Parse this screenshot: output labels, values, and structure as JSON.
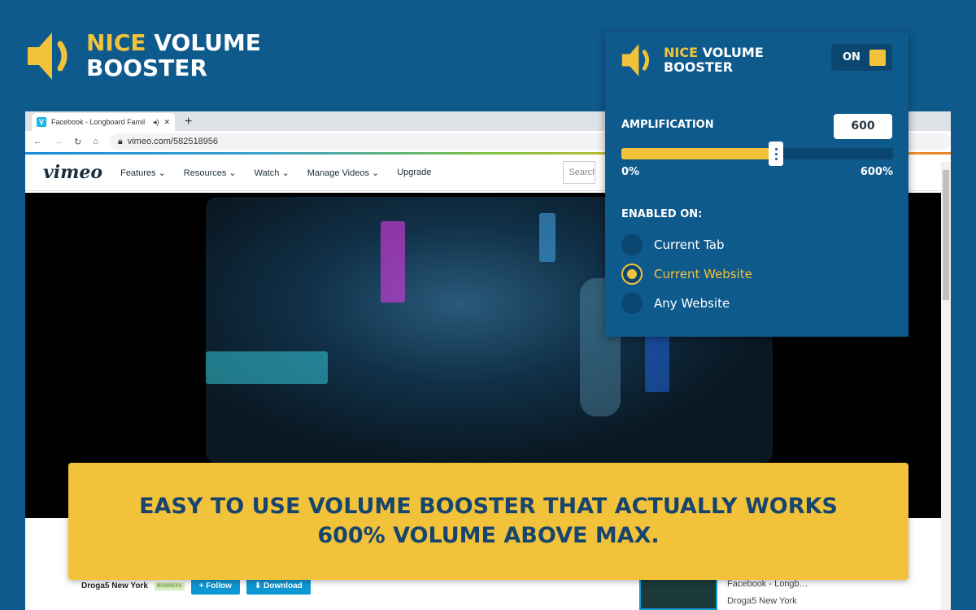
{
  "brand": {
    "nice": "NICE",
    "volume": "VOLUME",
    "booster": "BOOSTER"
  },
  "browser": {
    "tab_title": "Facebook - Longboard Famil",
    "new_tab": "+",
    "close": "✕",
    "url": "vimeo.com/582518956",
    "search_placeholder": "Search"
  },
  "vimeo": {
    "logo": "vimeo",
    "nav": [
      "Features ⌄",
      "Resources ⌄",
      "Watch ⌄",
      "Manage Videos ⌄",
      "Upgrade"
    ]
  },
  "popup": {
    "toggle_label": "ON",
    "amplification_label": "AMPLIFICATION",
    "amplification_value": "600",
    "slider_fill_fraction": 0.57,
    "min_label": "0%",
    "max_label": "600%",
    "enabled_on_label": "ENABLED ON:",
    "options": [
      {
        "label": "Current Tab",
        "selected": false
      },
      {
        "label": "Current Website",
        "selected": true
      },
      {
        "label": "Any Website",
        "selected": false
      }
    ]
  },
  "banner": {
    "line1": "EASY TO USE VOLUME BOOSTER THAT ACTUALLY WORKS",
    "line2": "600% VOLUME ABOVE MAX."
  },
  "below": {
    "channel": "Droga5 New York",
    "badge": "BUSINESS",
    "follow": "+ Follow",
    "download": "⬇ Download",
    "side_title": "Facebook - Longb…",
    "side_channel": "Droga5 New York"
  },
  "colors": {
    "bg": "#0f5a8c",
    "accent": "#f2c33a"
  }
}
